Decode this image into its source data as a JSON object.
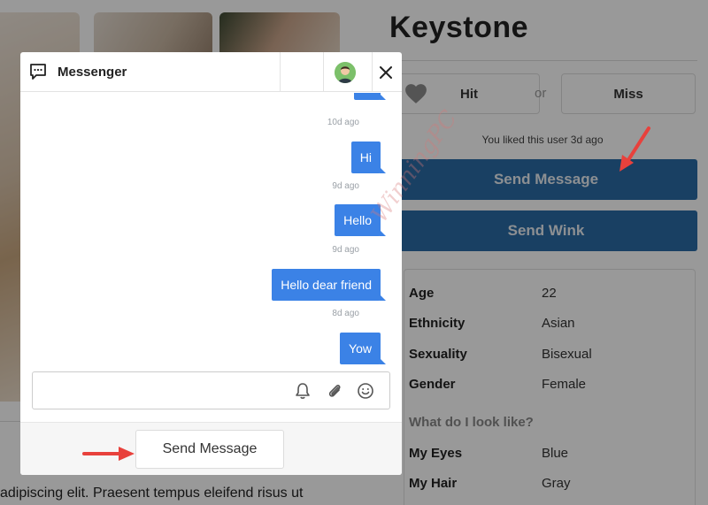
{
  "profile": {
    "name": "Keystone",
    "hit_label": "Hit",
    "or_label": "or",
    "miss_label": "Miss",
    "liked_status": "You liked this user 3d ago",
    "send_message_label": "Send Message",
    "send_wink_label": "Send Wink",
    "info": [
      {
        "key": "Age",
        "value": "22"
      },
      {
        "key": "Ethnicity",
        "value": "Asian"
      },
      {
        "key": "Sexuality",
        "value": "Bisexual"
      },
      {
        "key": "Gender",
        "value": "Female"
      }
    ],
    "looks_heading": "What do I look like?",
    "looks": [
      {
        "key": "My Eyes",
        "value": "Blue"
      },
      {
        "key": "My Hair",
        "value": "Gray"
      }
    ],
    "bio_excerpt": "adipiscing elit. Praesent tempus eleifend risus ut"
  },
  "messenger": {
    "title": "Messenger",
    "messages": [
      {
        "text": "",
        "time": "10d ago"
      },
      {
        "text": "Hi",
        "time": "9d ago"
      },
      {
        "text": "Hello",
        "time": "9d ago"
      },
      {
        "text": "Hello dear friend",
        "time": "8d ago"
      },
      {
        "text": "Yow",
        "time": ""
      }
    ],
    "input_value": "",
    "send_label": "Send Message",
    "icons": [
      "chat-icon",
      "avatar",
      "close-icon",
      "bell-icon",
      "paperclip-icon",
      "smiley-icon"
    ]
  },
  "watermark": "WinningPC",
  "colors": {
    "bubble": "#3b82e6",
    "primary_button": "#2a6ca6",
    "arrow": "#e8413c",
    "overlay": "rgba(0,0,0,0.40)"
  }
}
